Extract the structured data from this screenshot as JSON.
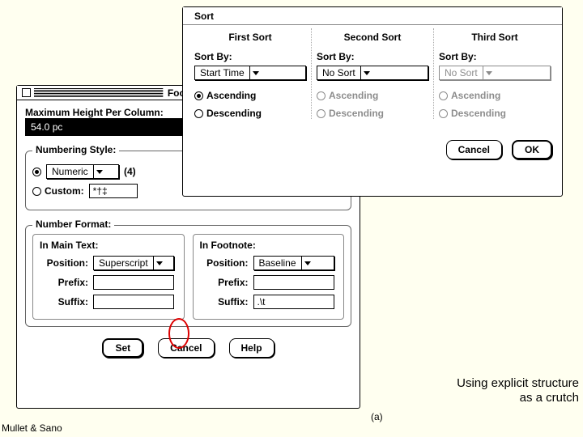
{
  "footnote": {
    "title": "Footnote",
    "max_height_label": "Maximum Height Per Column:",
    "max_height_value": "54.0 pc",
    "numbering_style_label": "Numbering Style:",
    "numeric_label": "Numeric",
    "numeric_example": "(4)",
    "custom_label": "Custom:",
    "custom_value": "*†‡",
    "number_format_label": "Number Format:",
    "in_main_text_label": "In Main Text:",
    "in_footnote_label": "In Footnote:",
    "position_label": "Position:",
    "prefix_label": "Prefix:",
    "suffix_label": "Suffix:",
    "main_position_value": "Superscript",
    "main_prefix_value": "",
    "main_suffix_value": "",
    "foot_position_value": "Baseline",
    "foot_prefix_value": "",
    "foot_suffix_value": ".\\t",
    "set_btn": "Set",
    "cancel_btn": "Cancel",
    "help_btn": "Help"
  },
  "sort": {
    "title": "Sort",
    "cols": [
      {
        "header": "First Sort",
        "sortby": "Sort By:",
        "value": "Start Time",
        "asc": "Ascending",
        "desc": "Descending",
        "enabled": true,
        "selected": "asc"
      },
      {
        "header": "Second Sort",
        "sortby": "Sort By:",
        "value": "No Sort",
        "asc": "Ascending",
        "desc": "Descending",
        "enabled": false,
        "selected": ""
      },
      {
        "header": "Third Sort",
        "sortby": "Sort By:",
        "value": "No Sort",
        "asc": "Ascending",
        "desc": "Descending",
        "enabled": false,
        "selected": ""
      }
    ],
    "cancel_btn": "Cancel",
    "ok_btn": "OK"
  },
  "caption_line1": "Using explicit structure",
  "caption_line2": "as a crutch",
  "fig_label": "(a)",
  "credit": "Mullet & Sano"
}
